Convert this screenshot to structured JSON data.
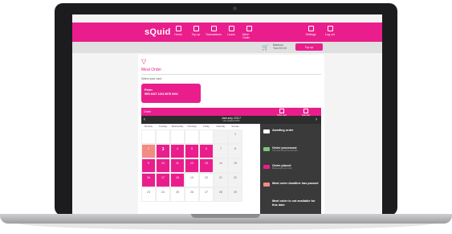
{
  "header": {
    "logo": "sQuid",
    "nav": [
      "Home",
      "Top-up",
      "Transactions",
      "Loans",
      "Meal Order"
    ],
    "account": [
      "Settings",
      "Log out"
    ]
  },
  "subbar": {
    "balance_label": "Balance",
    "balance_value": "Your £0.00",
    "topup_label": "Top up"
  },
  "page": {
    "title": "Meal Order",
    "select_label": "Select your card"
  },
  "card": {
    "name": "Peter",
    "number": "5RS 6327 1234 5678 0001"
  },
  "order": {
    "label": "Order",
    "toggles": [
      "Order view",
      "Calendar"
    ]
  },
  "calendar": {
    "month": "January 2017",
    "sub": "Last updated 0000",
    "days": [
      "Monday",
      "Tuesday",
      "Wednesday",
      "Thursday",
      "Friday",
      "Saturday",
      "Sunday"
    ],
    "cells": [
      {
        "d": "",
        "s": "blank"
      },
      {
        "d": "",
        "s": "blank"
      },
      {
        "d": "",
        "s": "blank"
      },
      {
        "d": "",
        "s": "blank"
      },
      {
        "d": "",
        "s": "blank"
      },
      {
        "d": "",
        "s": "weekend"
      },
      {
        "d": "1",
        "s": "weekend"
      },
      {
        "d": "2",
        "s": "salmon"
      },
      {
        "d": "3",
        "s": "pink today"
      },
      {
        "d": "4",
        "s": "pink"
      },
      {
        "d": "5",
        "s": "pink"
      },
      {
        "d": "6",
        "s": "pink"
      },
      {
        "d": "7",
        "s": "weekend"
      },
      {
        "d": "8",
        "s": "weekend"
      },
      {
        "d": "9",
        "s": "pink"
      },
      {
        "d": "10",
        "s": "pink"
      },
      {
        "d": "11",
        "s": "pink"
      },
      {
        "d": "12",
        "s": "pink"
      },
      {
        "d": "13",
        "s": "pink"
      },
      {
        "d": "14",
        "s": "weekend"
      },
      {
        "d": "15",
        "s": "weekend"
      },
      {
        "d": "16",
        "s": "pink"
      },
      {
        "d": "17",
        "s": "pink"
      },
      {
        "d": "18",
        "s": "pink"
      },
      {
        "d": "19",
        "s": ""
      },
      {
        "d": "20",
        "s": ""
      },
      {
        "d": "21",
        "s": "weekend"
      },
      {
        "d": "22",
        "s": "weekend"
      },
      {
        "d": "23",
        "s": ""
      },
      {
        "d": "24",
        "s": ""
      },
      {
        "d": "25",
        "s": ""
      },
      {
        "d": "26",
        "s": ""
      },
      {
        "d": "27",
        "s": ""
      },
      {
        "d": "28",
        "s": "weekend"
      },
      {
        "d": "29",
        "s": "weekend"
      }
    ]
  },
  "legend": [
    {
      "label": "Awaiting order",
      "sub": "",
      "color": "#ffffff"
    },
    {
      "label": "Order processed",
      "sub": "Your order cannot be amended",
      "color": "#7bc67b"
    },
    {
      "label": "Order placed",
      "sub": "Please select your order",
      "color": "#e91e8c"
    },
    {
      "label": "Meal order deadline has passed",
      "sub": "",
      "color": "#f28b82"
    },
    {
      "label": "Meal order is not available for this date",
      "sub": "",
      "color": "#3a3a3a"
    }
  ],
  "colors": {
    "brand": "#e91e8c",
    "secondary": "#f28b82"
  }
}
